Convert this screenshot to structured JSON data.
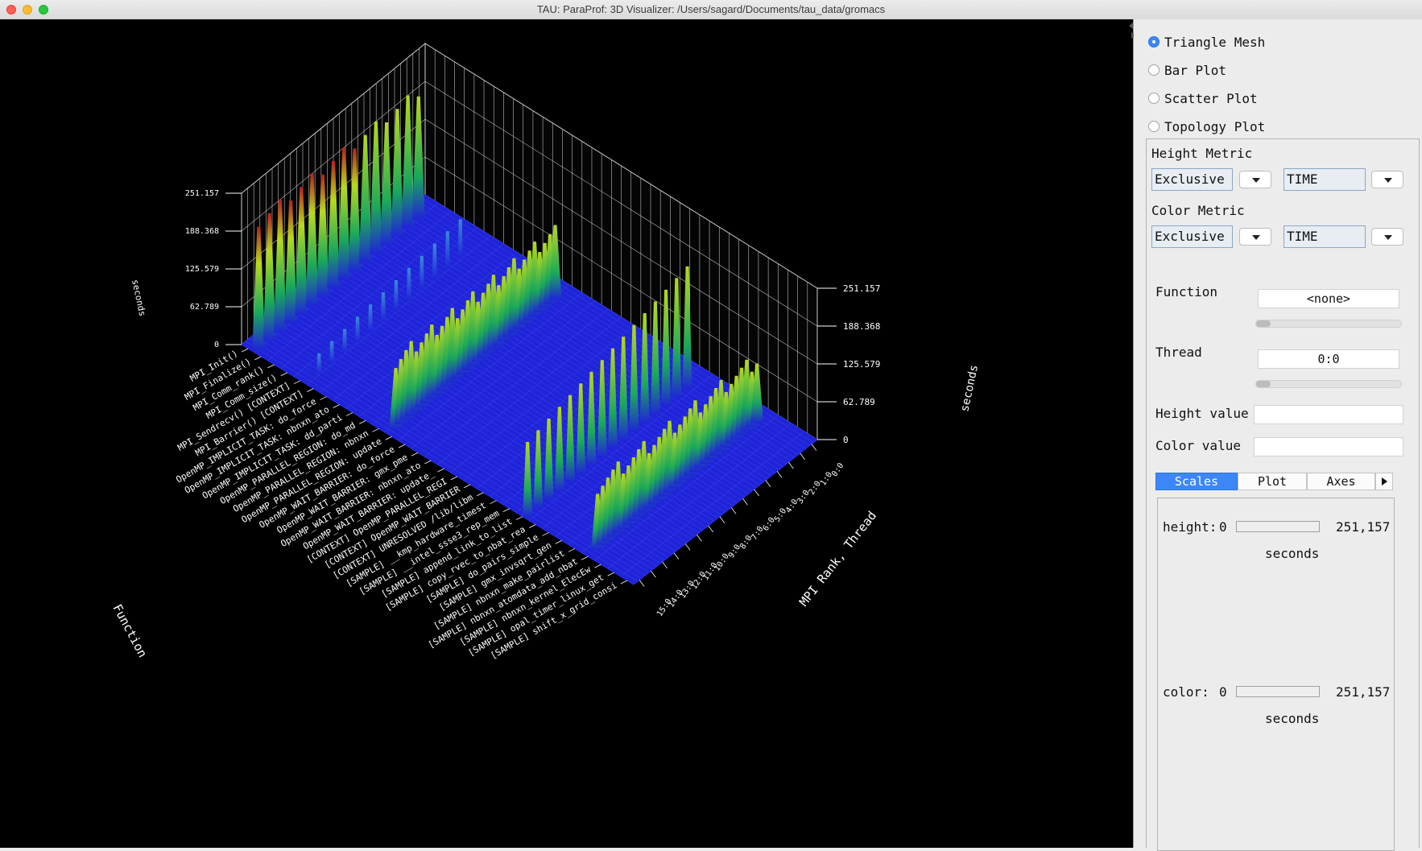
{
  "window": {
    "title": "TAU: ParaProf: 3D Visualizer: /Users/sagard/Documents/tau_data/gromacs"
  },
  "plot_types": [
    {
      "label": "Triangle Mesh",
      "selected": true
    },
    {
      "label": "Bar Plot",
      "selected": false
    },
    {
      "label": "Scatter Plot",
      "selected": false
    },
    {
      "label": "Topology Plot",
      "selected": false
    }
  ],
  "height_metric": {
    "label": "Height Metric",
    "kind": "Exclusive",
    "metric": "TIME"
  },
  "color_metric": {
    "label": "Color Metric",
    "kind": "Exclusive",
    "metric": "TIME"
  },
  "selection": {
    "function_label": "Function",
    "function_value": "<none>",
    "thread_label": "Thread",
    "thread_value": "0:0",
    "height_value_label": "Height value",
    "height_value": "",
    "color_value_label": "Color value",
    "color_value": ""
  },
  "tabs": [
    {
      "label": "Scales",
      "active": true
    },
    {
      "label": "Plot",
      "active": false
    },
    {
      "label": "Axes",
      "active": false
    }
  ],
  "scales": {
    "height_label": "height:",
    "height_min": "0",
    "height_max": "251,157",
    "height_unit": "seconds",
    "color_label": "color:",
    "color_min": "0",
    "color_max": "251,157",
    "color_unit": "seconds"
  },
  "plot3d": {
    "axis_function_label": "Function",
    "axis_thread_label": "MPI Rank, Thread",
    "axis_value_label": "seconds",
    "value_ticks": [
      "251.157",
      "188.368",
      "125.579",
      "62.789",
      "0"
    ],
    "function_labels": [
      "MPI_Init()",
      "MPI_Finalize()",
      "MPI_Comm_rank()",
      "MPI_Comm_size()",
      "MPI_Sendrecv() [CONTEXT]",
      "MPI_Barrier() [CONTEXT]",
      "OpenMP_IMPLICIT_TASK: do_force",
      "OpenMP_IMPLICIT_TASK: nbnxn_ato",
      "OpenMP_IMPLICIT_TASK: dd_parti",
      "OpenMP_PARALLEL_REGION: do_md",
      "OpenMP_PARALLEL_REGION: nbnxn",
      "OpenMP_PARALLEL_REGION: update",
      "OpenMP_WAIT_BARRIER: do_force",
      "OpenMP_WAIT_BARRIER: gmx_pme",
      "OpenMP_WAIT_BARRIER: nbnxn_ato",
      "OpenMP_WAIT_BARRIER: update_",
      "[CONTEXT] OpenMP_PARALLEL_REGI",
      "[CONTEXT] OpenMP_WAIT_BARRIER",
      "[CONTEXT] UNRESOLVED /lib/libm",
      "[SAMPLE] __kmp_hardware_timest",
      "[SAMPLE] __intel_ssse3_rep_mem",
      "[SAMPLE] append_link_to_list",
      "[SAMPLE] copy_rvec_to_nbat_rea",
      "[SAMPLE] do_pairs_simple",
      "[SAMPLE] gmx_invsqrt_gen",
      "[SAMPLE] nbnxn_make_pairlist",
      "[SAMPLE] nbnxn_atomdata_add_nbat",
      "[SAMPLE] nbnxn_kernel_ElecEw",
      "[SAMPLE] opal_timer_linux_get",
      "[SAMPLE] shift_x_grid_consi"
    ],
    "thread_labels": [
      "0:0",
      "1:0",
      "2:0",
      "3:0",
      "4:0",
      "5:0",
      "6:0",
      "7:0",
      "8:0",
      "9:0",
      "10:0",
      "11:0",
      "12:0",
      "13:0",
      "14:0",
      "15:0"
    ]
  },
  "colors": {
    "background": "#000000",
    "mesh_base": "#1f24d8",
    "mesh_mid": "#1aa85a",
    "mesh_high": "#b8d91f",
    "mesh_peak": "#b4221a",
    "accent": "#3d86f5"
  }
}
